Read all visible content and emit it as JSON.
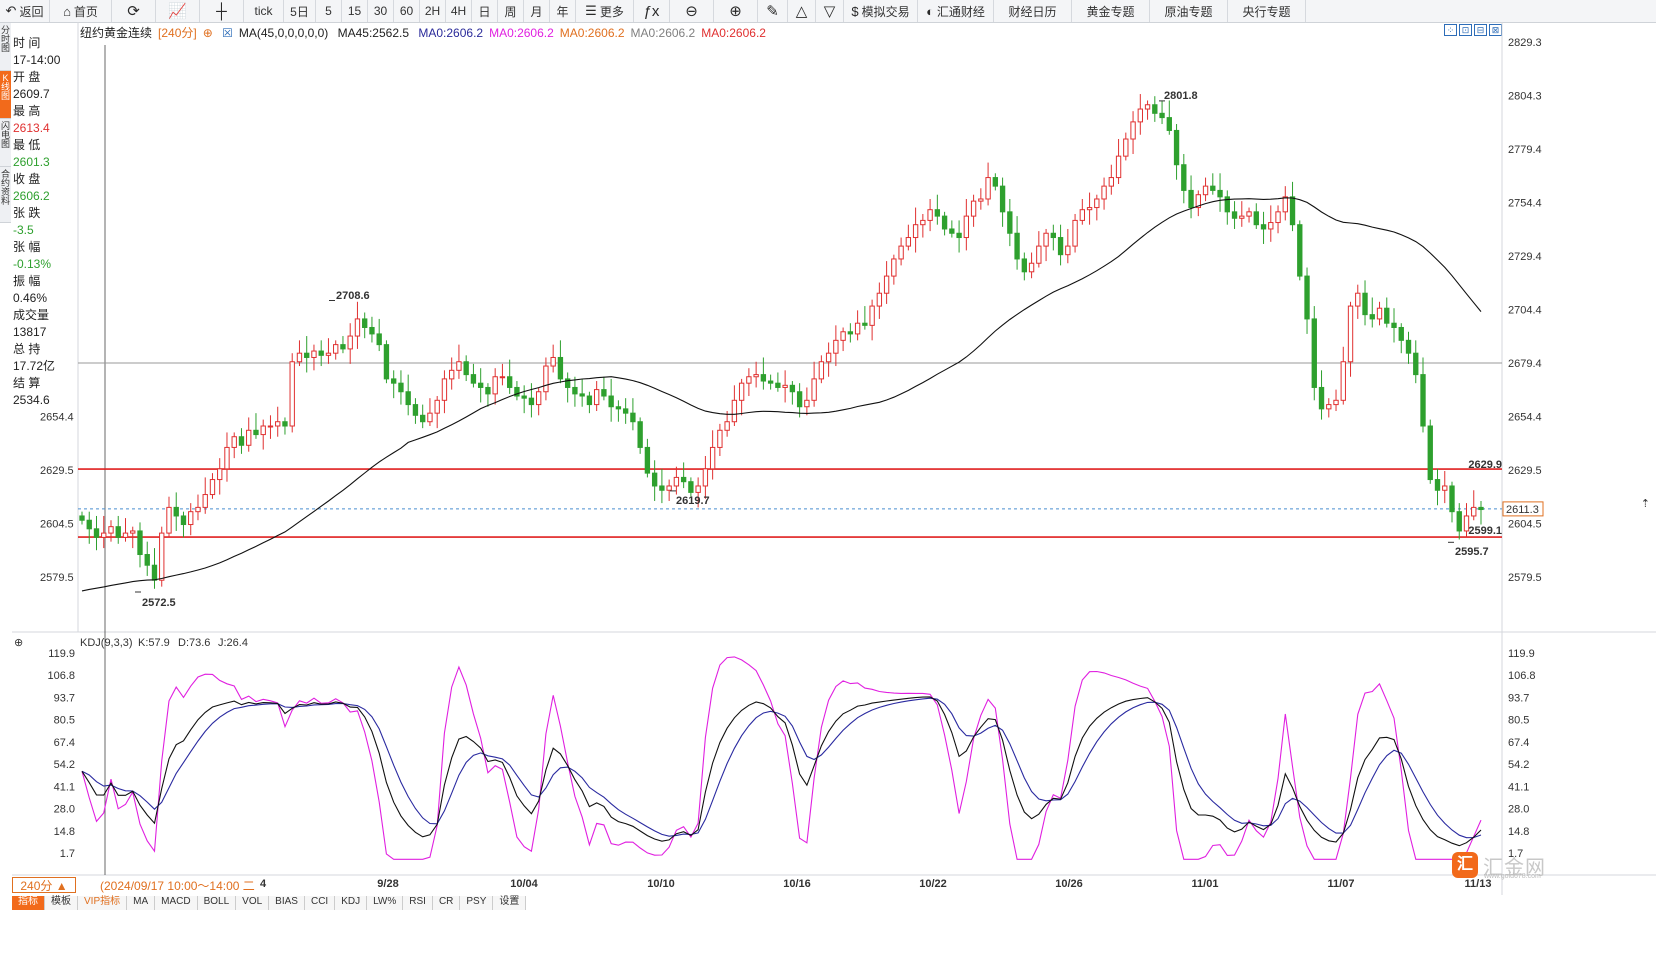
{
  "toolbar": [
    {
      "name": "back-button",
      "icon": "back-icon",
      "glyph": "↶",
      "label": "返回",
      "w": 50
    },
    {
      "name": "home-button",
      "icon": "home-icon",
      "glyph": "⌂",
      "label": "首页",
      "w": 62
    },
    {
      "name": "refresh-button",
      "icon": "refresh-icon",
      "glyph": "⟳",
      "label": "",
      "w": 44
    },
    {
      "name": "chart-type-button",
      "icon": "chart-icon",
      "glyph": "📈",
      "label": "",
      "w": 44
    },
    {
      "name": "candle-button",
      "icon": "candlestick-icon",
      "glyph": "┼",
      "label": "",
      "w": 44
    },
    {
      "name": "tick-button",
      "icon": "",
      "glyph": "",
      "label": "tick",
      "w": 40
    },
    {
      "name": "period-5d-button",
      "icon": "",
      "glyph": "",
      "label": "5日",
      "w": 32
    },
    {
      "name": "period-5-button",
      "icon": "",
      "glyph": "",
      "label": "5",
      "w": 26
    },
    {
      "name": "period-15-button",
      "icon": "",
      "glyph": "",
      "label": "15",
      "w": 26
    },
    {
      "name": "period-30-button",
      "icon": "",
      "glyph": "",
      "label": "30",
      "w": 26
    },
    {
      "name": "period-60-button",
      "icon": "",
      "glyph": "",
      "label": "60",
      "w": 26
    },
    {
      "name": "period-2h-button",
      "icon": "",
      "glyph": "",
      "label": "2H",
      "w": 26
    },
    {
      "name": "period-4h-button",
      "icon": "",
      "glyph": "",
      "label": "4H",
      "w": 26
    },
    {
      "name": "period-day-button",
      "icon": "",
      "glyph": "",
      "label": "日",
      "w": 26
    },
    {
      "name": "period-week-button",
      "icon": "",
      "glyph": "",
      "label": "周",
      "w": 26
    },
    {
      "name": "period-month-button",
      "icon": "",
      "glyph": "",
      "label": "月",
      "w": 26
    },
    {
      "name": "period-year-button",
      "icon": "",
      "glyph": "",
      "label": "年",
      "w": 26
    },
    {
      "name": "more-button",
      "icon": "menu-icon",
      "glyph": "☰",
      "label": "更多",
      "w": 58
    },
    {
      "name": "formula-button",
      "icon": "formula-icon",
      "glyph": "ƒx",
      "label": "",
      "w": 36
    },
    {
      "name": "zoom-out-button",
      "icon": "zoom-out-icon",
      "glyph": "⊖",
      "label": "",
      "w": 44
    },
    {
      "name": "zoom-in-button",
      "icon": "zoom-in-icon",
      "glyph": "⊕",
      "label": "",
      "w": 44
    },
    {
      "name": "draw-button",
      "icon": "pencil-icon",
      "glyph": "✎",
      "label": "",
      "w": 30
    },
    {
      "name": "tri-up-button",
      "icon": "triangle-up-icon",
      "glyph": "△",
      "label": "",
      "w": 28
    },
    {
      "name": "tri-down-button",
      "icon": "triangle-down-icon",
      "glyph": "▽",
      "label": "",
      "w": 28
    },
    {
      "name": "sim-trade-button",
      "icon": "dollar-icon",
      "glyph": "$",
      "label": "模拟交易",
      "w": 74
    },
    {
      "name": "huitong-button",
      "icon": "circle-icon",
      "glyph": "◐",
      "label": "汇通财经",
      "w": 76
    },
    {
      "name": "calendar-button",
      "icon": "",
      "glyph": "",
      "label": "财经日历",
      "w": 78
    },
    {
      "name": "gold-topic-button",
      "icon": "",
      "glyph": "",
      "label": "黄金专题",
      "w": 78
    },
    {
      "name": "oil-topic-button",
      "icon": "",
      "glyph": "",
      "label": "原油专题",
      "w": 78
    },
    {
      "name": "cb-topic-button",
      "icon": "",
      "glyph": "",
      "label": "央行专题",
      "w": 78
    }
  ],
  "side_tabs": [
    {
      "label": "分时图",
      "active": false
    },
    {
      "label": "K线图",
      "active": true
    },
    {
      "label": "闪电图",
      "active": false
    },
    {
      "label": "合约资料",
      "active": false
    }
  ],
  "header": {
    "symbol": "纽约黄金连续",
    "period": "[240分]",
    "ma_main": "MA(45,0,0,0,0,0)",
    "ma45": "MA45:2562.5",
    "ma_values": [
      {
        "text": "MA0:2606.2",
        "color": "#2a2a9a"
      },
      {
        "text": "MA0:2606.2",
        "color": "#e020e0"
      },
      {
        "text": "MA0:2606.2",
        "color": "#e07020"
      },
      {
        "text": "MA0:2606.2",
        "color": "#808080"
      },
      {
        "text": "MA0:2606.2",
        "color": "#e03030"
      }
    ]
  },
  "info_panel": [
    {
      "label": "时 间",
      "value": "17-14:00",
      "vcolor": "#222"
    },
    {
      "label": "开 盘",
      "value": "2609.7",
      "vcolor": "#222"
    },
    {
      "label": "最 高",
      "value": "2613.4",
      "vcolor": "#e03030"
    },
    {
      "label": "最 低",
      "value": "2601.3",
      "vcolor": "#2ea02e"
    },
    {
      "label": "收 盘",
      "value": "2606.2",
      "vcolor": "#2ea02e"
    },
    {
      "label": "张 跌",
      "value": "-3.5",
      "vcolor": "#2ea02e"
    },
    {
      "label": "张 幅",
      "value": "-0.13%",
      "vcolor": "#2ea02e"
    },
    {
      "label": "振 幅",
      "value": "0.46%",
      "vcolor": "#222"
    },
    {
      "label": "成交量",
      "value": "13817",
      "vcolor": "#222"
    },
    {
      "label": "总 持",
      "value": "17.72亿",
      "vcolor": "#222"
    },
    {
      "label": "结 算",
      "value": "2534.6",
      "vcolor": "#222"
    }
  ],
  "window_buttons": [
    "⁘",
    "⊡",
    "⊟",
    "⊠"
  ],
  "price_axis": {
    "ticks": [
      2829.3,
      2804.3,
      2779.4,
      2754.4,
      2729.4,
      2704.4,
      2679.4,
      2654.4,
      2629.5,
      2604.5,
      2579.5
    ],
    "left_ticks": [
      2654.4,
      2629.5,
      2604.5,
      2579.5
    ],
    "current": "2611.3",
    "support_line": 2629.9,
    "support_label": "2629.9",
    "resist_line": 2599.1,
    "resist_label": "2599.1",
    "ref_line": 2679.4,
    "dashed_line": 2611.3,
    "annotations": [
      {
        "label": "2801.8",
        "color": "#e03030"
      },
      {
        "label": "2708.6",
        "color": "#e03030"
      },
      {
        "label": "2572.5",
        "color": "#2ea02e"
      },
      {
        "label": "2619.7",
        "color": "#2ea02e"
      },
      {
        "label": "2595.7",
        "color": "#2ea02e"
      }
    ]
  },
  "kdj": {
    "title": "KDJ(9,3,3)",
    "k": "K:57.9",
    "d": "D:73.6",
    "j": "J:26.4",
    "ticks": [
      "119.9",
      "106.8",
      "93.7",
      "80.5",
      "67.4",
      "54.2",
      "41.1",
      "28.0",
      "14.8",
      "1.7"
    ]
  },
  "bottom": {
    "period_box": "240分 ▲",
    "date_tip": "2024/09/17 10:00～14:00 二",
    "x_labels": [
      "4",
      "9/28",
      "10/04",
      "10/10",
      "10/16",
      "10/22",
      "10/26",
      "11/01",
      "11/07",
      "11/13"
    ],
    "indicator_tabs": [
      {
        "label": "指标",
        "active": true,
        "vip": false
      },
      {
        "label": "模板",
        "active": false,
        "vip": false
      },
      {
        "label": "VIP指标",
        "active": false,
        "vip": true
      },
      {
        "label": "MA",
        "active": false,
        "vip": false
      },
      {
        "label": "MACD",
        "active": false,
        "vip": false
      },
      {
        "label": "BOLL",
        "active": false,
        "vip": false
      },
      {
        "label": "VOL",
        "active": false,
        "vip": false
      },
      {
        "label": "BIAS",
        "active": false,
        "vip": false
      },
      {
        "label": "CCI",
        "active": false,
        "vip": false
      },
      {
        "label": "KDJ",
        "active": false,
        "vip": false
      },
      {
        "label": "LW%",
        "active": false,
        "vip": false
      },
      {
        "label": "RSI",
        "active": false,
        "vip": false
      },
      {
        "label": "CR",
        "active": false,
        "vip": false
      },
      {
        "label": "PSY",
        "active": false,
        "vip": false
      },
      {
        "label": "设置",
        "active": false,
        "vip": false
      }
    ]
  },
  "logo": {
    "badge": "汇",
    "name": "汇金网",
    "url": "www.gold678.com"
  },
  "colors": {
    "up": "#e03030",
    "down": "#2ea02e",
    "ma": "#111111",
    "k": "#111111",
    "d": "#2a2aa0",
    "j": "#e020e0",
    "accent": "#f26a1b"
  },
  "chart_data": {
    "type": "candlestick",
    "title": "纽约黄金连续",
    "period": "240分",
    "y_range": [
      2565,
      2835
    ],
    "x_labels": [
      "9/28",
      "10/04",
      "10/10",
      "10/16",
      "10/22",
      "10/26",
      "11/01",
      "11/07",
      "11/13"
    ],
    "candles_close_path": [
      2606,
      2602,
      2598,
      2600,
      2603,
      2598,
      2600,
      2601,
      2590,
      2585,
      2578,
      2600,
      2612,
      2608,
      2604,
      2610,
      2612,
      2618,
      2625,
      2630,
      2640,
      2645,
      2641,
      2648,
      2646,
      2650,
      2650,
      2652,
      2650,
      2680,
      2684,
      2682,
      2685,
      2683,
      2684,
      2688,
      2686,
      2692,
      2700,
      2696,
      2693,
      2688,
      2672,
      2670,
      2666,
      2660,
      2655,
      2652,
      2656,
      2662,
      2672,
      2676,
      2680,
      2674,
      2670,
      2668,
      2665,
      2673,
      2673,
      2668,
      2664,
      2663,
      2660,
      2666,
      2678,
      2682,
      2672,
      2668,
      2665,
      2664,
      2660,
      2667,
      2664,
      2659,
      2658,
      2656,
      2652,
      2640,
      2628,
      2622,
      2620,
      2622,
      2626,
      2624,
      2619,
      2622,
      2630,
      2640,
      2648,
      2652,
      2662,
      2670,
      2673,
      2674,
      2671,
      2670,
      2668,
      2669,
      2666,
      2659,
      2662,
      2672,
      2680,
      2684,
      2690,
      2694,
      2693,
      2698,
      2697,
      2706,
      2712,
      2720,
      2728,
      2734,
      2738,
      2744,
      2746,
      2751,
      2748,
      2742,
      2740,
      2738,
      2748,
      2755,
      2756,
      2766,
      2762,
      2750,
      2740,
      2728,
      2722,
      2726,
      2734,
      2740,
      2738,
      2730,
      2734,
      2746,
      2751,
      2752,
      2756,
      2762,
      2766,
      2776,
      2784,
      2792,
      2798,
      2800,
      2796,
      2794,
      2788,
      2772,
      2760,
      2752,
      2758,
      2762,
      2760,
      2757,
      2750,
      2747,
      2748,
      2750,
      2744,
      2742,
      2745,
      2750,
      2757,
      2744,
      2720,
      2700,
      2668,
      2658,
      2660,
      2662,
      2680,
      2706,
      2712,
      2702,
      2700,
      2705,
      2698,
      2696,
      2690,
      2684,
      2674,
      2650,
      2625,
      2620,
      2622,
      2610,
      2601,
      2608,
      2612,
      2611
    ],
    "ma45_start": 2573,
    "kdj_range": [
      0,
      122
    ]
  }
}
